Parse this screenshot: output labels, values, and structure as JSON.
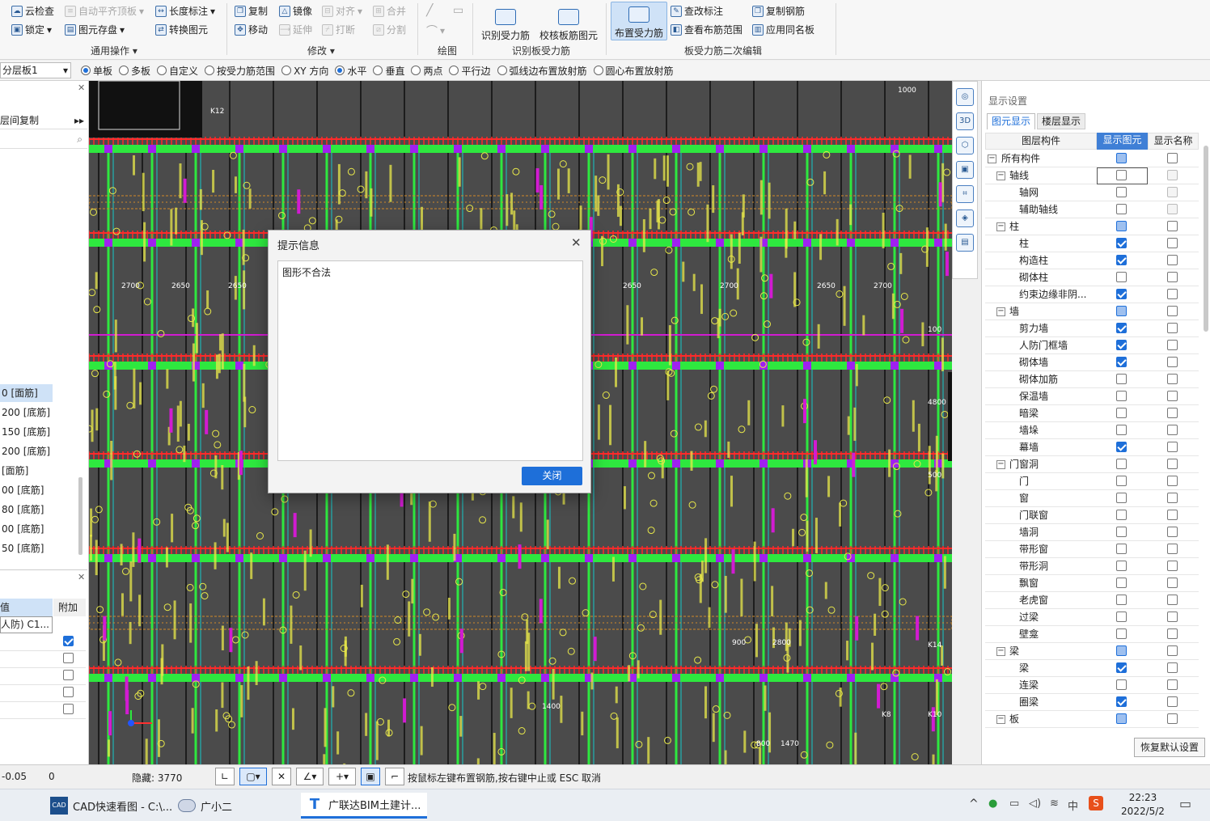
{
  "ribbon": {
    "general": {
      "cloud_check": "云检查",
      "auto_align": "自动平齐顶板",
      "length_dim": "长度标注",
      "lock": "锁定",
      "element_save": "图元存盘",
      "convert_element": "转换图元",
      "group_label": "通用操作"
    },
    "modify": {
      "copy": "复制",
      "mirror": "镜像",
      "align": "对齐",
      "merge": "合并",
      "move": "移动",
      "extend": "延伸",
      "break": "打断",
      "split": "分割",
      "group_label": "修改"
    },
    "draw": {
      "group_label": "绘图"
    },
    "identify": {
      "identify_rebar": "识别受力筋",
      "verify_rebar": "校核板筋图元",
      "group_label": "识别板受力筋"
    },
    "edit2": {
      "place_rebar": "布置受力筋",
      "check_mark": "查改标注",
      "view_range": "查看布筋范围",
      "copy_rebar": "复制钢筋",
      "apply_same": "应用同名板",
      "group_label": "板受力筋二次编辑"
    }
  },
  "toolbar2": {
    "layer_select": "分层板1",
    "options": [
      {
        "label": "单板",
        "on": true
      },
      {
        "label": "多板",
        "on": false
      },
      {
        "label": "自定义",
        "on": false
      },
      {
        "label": "按受力筋范围",
        "on": false
      },
      {
        "label": "XY 方向",
        "on": false
      },
      {
        "label": "水平",
        "on": true
      },
      {
        "label": "垂直",
        "on": false
      },
      {
        "label": "两点",
        "on": false
      },
      {
        "label": "平行边",
        "on": false
      },
      {
        "label": "弧线边布置放射筋",
        "on": false
      },
      {
        "label": "圆心布置放射筋",
        "on": false
      }
    ]
  },
  "left_panel": {
    "copy_between_floors": "层间复制",
    "items": [
      "0 [面筋]",
      "200 [底筋]",
      "150 [底筋]",
      "200 [底筋]",
      "[面筋]",
      "00 [底筋]",
      "80 [底筋]",
      "00 [底筋]",
      "50 [底筋]"
    ],
    "prop_header_value": "值",
    "prop_header_extra": "附加",
    "prop_first_value": "人防) C1..."
  },
  "right_panel": {
    "title": "显示设置",
    "tab_element": "图元显示",
    "tab_floor": "楼层显示",
    "col_component": "图层构件",
    "col_show": "显示图元",
    "col_name": "显示名称",
    "restore_button": "恢复默认设置",
    "rows": [
      {
        "label": "所有构件",
        "level": 0,
        "toggle": false,
        "show": "part",
        "name": "off"
      },
      {
        "label": "轴线",
        "level": 1,
        "toggle": true,
        "show": "off",
        "name": "dim"
      },
      {
        "label": "轴网",
        "level": 2,
        "toggle": false,
        "show": "off",
        "name": "dim"
      },
      {
        "label": "辅助轴线",
        "level": 2,
        "toggle": false,
        "show": "off",
        "name": "dim"
      },
      {
        "label": "柱",
        "level": 1,
        "toggle": true,
        "show": "part",
        "name": "off"
      },
      {
        "label": "柱",
        "level": 2,
        "toggle": false,
        "show": "on",
        "name": "off"
      },
      {
        "label": "构造柱",
        "level": 2,
        "toggle": false,
        "show": "on",
        "name": "off"
      },
      {
        "label": "砌体柱",
        "level": 2,
        "toggle": false,
        "show": "off",
        "name": "off"
      },
      {
        "label": "约束边缘非阴...",
        "level": 2,
        "toggle": false,
        "show": "on",
        "name": "off"
      },
      {
        "label": "墙",
        "level": 1,
        "toggle": true,
        "show": "part",
        "name": "off"
      },
      {
        "label": "剪力墙",
        "level": 2,
        "toggle": false,
        "show": "on",
        "name": "off"
      },
      {
        "label": "人防门框墙",
        "level": 2,
        "toggle": false,
        "show": "on",
        "name": "off"
      },
      {
        "label": "砌体墙",
        "level": 2,
        "toggle": false,
        "show": "on",
        "name": "off"
      },
      {
        "label": "砌体加筋",
        "level": 2,
        "toggle": false,
        "show": "off",
        "name": "off"
      },
      {
        "label": "保温墙",
        "level": 2,
        "toggle": false,
        "show": "off",
        "name": "off"
      },
      {
        "label": "暗梁",
        "level": 2,
        "toggle": false,
        "show": "off",
        "name": "off"
      },
      {
        "label": "墙垛",
        "level": 2,
        "toggle": false,
        "show": "off",
        "name": "off"
      },
      {
        "label": "幕墙",
        "level": 2,
        "toggle": false,
        "show": "on",
        "name": "off"
      },
      {
        "label": "门窗洞",
        "level": 1,
        "toggle": true,
        "show": "off",
        "name": "off"
      },
      {
        "label": "门",
        "level": 2,
        "toggle": false,
        "show": "off",
        "name": "off"
      },
      {
        "label": "窗",
        "level": 2,
        "toggle": false,
        "show": "off",
        "name": "off"
      },
      {
        "label": "门联窗",
        "level": 2,
        "toggle": false,
        "show": "off",
        "name": "off"
      },
      {
        "label": "墙洞",
        "level": 2,
        "toggle": false,
        "show": "off",
        "name": "off"
      },
      {
        "label": "带形窗",
        "level": 2,
        "toggle": false,
        "show": "off",
        "name": "off"
      },
      {
        "label": "带形洞",
        "level": 2,
        "toggle": false,
        "show": "off",
        "name": "off"
      },
      {
        "label": "飘窗",
        "level": 2,
        "toggle": false,
        "show": "off",
        "name": "off"
      },
      {
        "label": "老虎窗",
        "level": 2,
        "toggle": false,
        "show": "off",
        "name": "off"
      },
      {
        "label": "过梁",
        "level": 2,
        "toggle": false,
        "show": "off",
        "name": "off"
      },
      {
        "label": "壁龛",
        "level": 2,
        "toggle": false,
        "show": "off",
        "name": "off"
      },
      {
        "label": "梁",
        "level": 1,
        "toggle": true,
        "show": "part",
        "name": "off"
      },
      {
        "label": "梁",
        "level": 2,
        "toggle": false,
        "show": "on",
        "name": "off"
      },
      {
        "label": "连梁",
        "level": 2,
        "toggle": false,
        "show": "off",
        "name": "off"
      },
      {
        "label": "圈梁",
        "level": 2,
        "toggle": false,
        "show": "on",
        "name": "off"
      },
      {
        "label": "板",
        "level": 1,
        "toggle": true,
        "show": "part",
        "name": "off"
      }
    ]
  },
  "dialog": {
    "title": "提示信息",
    "message": "图形不合法",
    "close_button": "关闭"
  },
  "canvas_labels": [
    "2700",
    "2650",
    "2650",
    "2700",
    "2650",
    "2700",
    "2650",
    "2700",
    "4800",
    "900",
    "800",
    "1470",
    "1000",
    "500",
    "100",
    "1400",
    "2800",
    "K12",
    "K14",
    "K8",
    "K10"
  ],
  "statusbar": {
    "coord": "-0.05",
    "zero": "0",
    "hidden": "隐藏: 3770",
    "hint": "按鼠标左键布置钢筋,按右键中止或 ESC 取消"
  },
  "taskbar": {
    "app1": "CAD快速看图 - C:\\...",
    "app2": "广小二",
    "app3": "广联达BIM土建计...",
    "time": "22:23",
    "date": "2022/5/2",
    "ime": "中"
  },
  "colors": {
    "canvas_bg": "#4b4b4b",
    "beam_green": "#2ee83f",
    "rebar_red": "#ff2a2a",
    "text_yellow": "#e8e84a",
    "accent_blue": "#1e6fd9",
    "magenta": "#d21bd2"
  }
}
